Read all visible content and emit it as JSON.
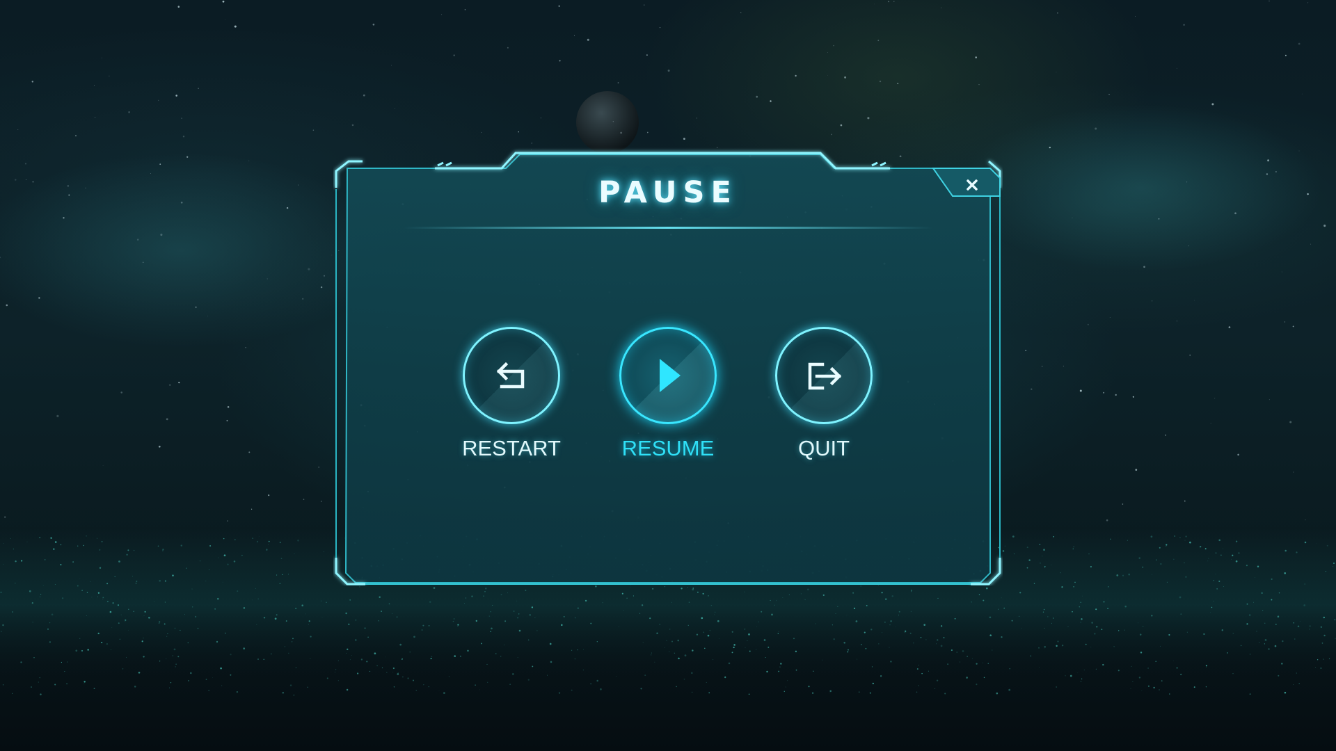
{
  "window": {
    "title": "PAUSE"
  },
  "close_button": {
    "icon": "close-icon",
    "glyph": "×"
  },
  "actions": [
    {
      "id": "restart",
      "label": "RESTART",
      "icon": "restart-icon"
    },
    {
      "id": "resume",
      "label": "RESUME",
      "icon": "play-icon"
    },
    {
      "id": "quit",
      "label": "QUIT",
      "icon": "exit-icon"
    }
  ],
  "colors": {
    "accent": "#2fe0f7",
    "frame": "#59e6f2",
    "panel": "#0f3a44",
    "text": "#e2f9fc"
  }
}
